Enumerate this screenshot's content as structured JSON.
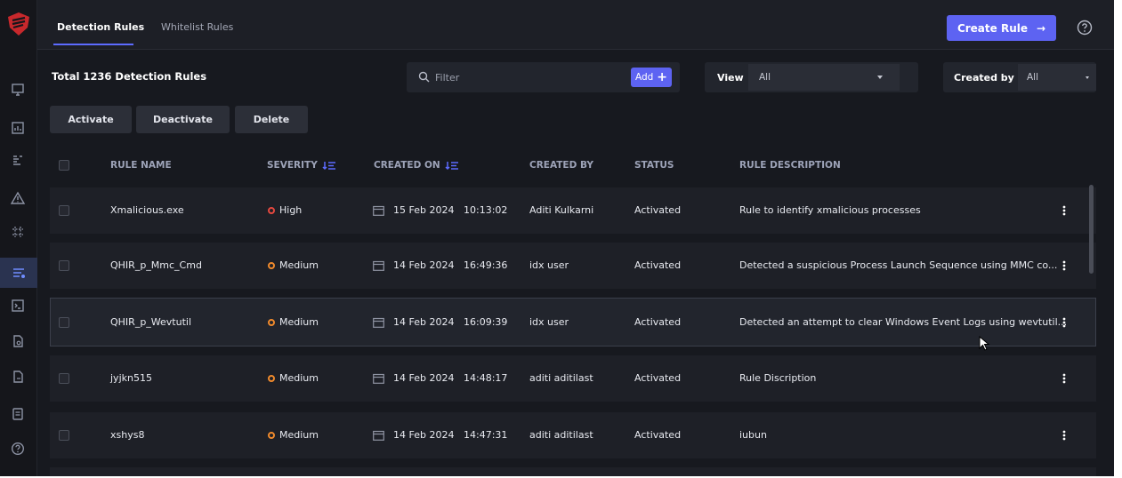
{
  "tabs": [
    {
      "label": "Detection Rules",
      "active": true
    },
    {
      "label": "Whitelist Rules",
      "active": false
    }
  ],
  "header": {
    "create_label": "Create Rule",
    "create_arrow": "→"
  },
  "toolbar": {
    "title": "Total 1236 Detection Rules",
    "filter_placeholder": "Filter",
    "add_label": "Add",
    "add_plus": "+",
    "view_label": "View",
    "view_value": "All",
    "created_by_label": "Created by",
    "created_by_value": "All"
  },
  "actions": {
    "activate": "Activate",
    "deactivate": "Deactivate",
    "delete": "Delete"
  },
  "columns": {
    "rule_name": "RULE NAME",
    "severity": "SEVERITY",
    "created_on": "CREATED ON",
    "created_by": "CREATED BY",
    "status": "STATUS",
    "rule_description": "RULE DESCRIPTION"
  },
  "rows": [
    {
      "name": "Xmalicious.exe",
      "severity": "High",
      "date": "15 Feb 2024",
      "time": "10:13:02",
      "created_by": "Aditi Kulkarni",
      "status": "Activated",
      "description": "Rule to identify xmalicious processes"
    },
    {
      "name": "QHIR_p_Mmc_Cmd",
      "severity": "Medium",
      "date": "14 Feb 2024",
      "time": "16:49:36",
      "created_by": "idx user",
      "status": "Activated",
      "description": "Detected a suspicious Process Launch Sequence using MMC co..."
    },
    {
      "name": "QHIR_p_Wevtutil",
      "severity": "Medium",
      "date": "14 Feb 2024",
      "time": "16:09:39",
      "created_by": "idx user",
      "status": "Activated",
      "description": "Detected an attempt to clear Windows Event Logs using wevtutil..."
    },
    {
      "name": "jyjkn515",
      "severity": "Medium",
      "date": "14 Feb 2024",
      "time": "14:48:17",
      "created_by": "aditi aditilast",
      "status": "Activated",
      "description": "Rule Discription"
    },
    {
      "name": "xshys8",
      "severity": "Medium",
      "date": "14 Feb 2024",
      "time": "14:47:31",
      "created_by": "aditi aditilast",
      "status": "Activated",
      "description": "iubun"
    }
  ],
  "colors": {
    "accent": "#5d63f2",
    "high": "#e5483f",
    "medium": "#f08a2c",
    "background": "#17191f"
  },
  "icons": {
    "sidebar": [
      "monitor-icon",
      "chart-icon",
      "list-icon",
      "alert-icon",
      "grid-icon",
      "rules-icon",
      "terminal-icon",
      "file-icon",
      "file-copy-icon",
      "document-icon",
      "help-icon"
    ]
  }
}
